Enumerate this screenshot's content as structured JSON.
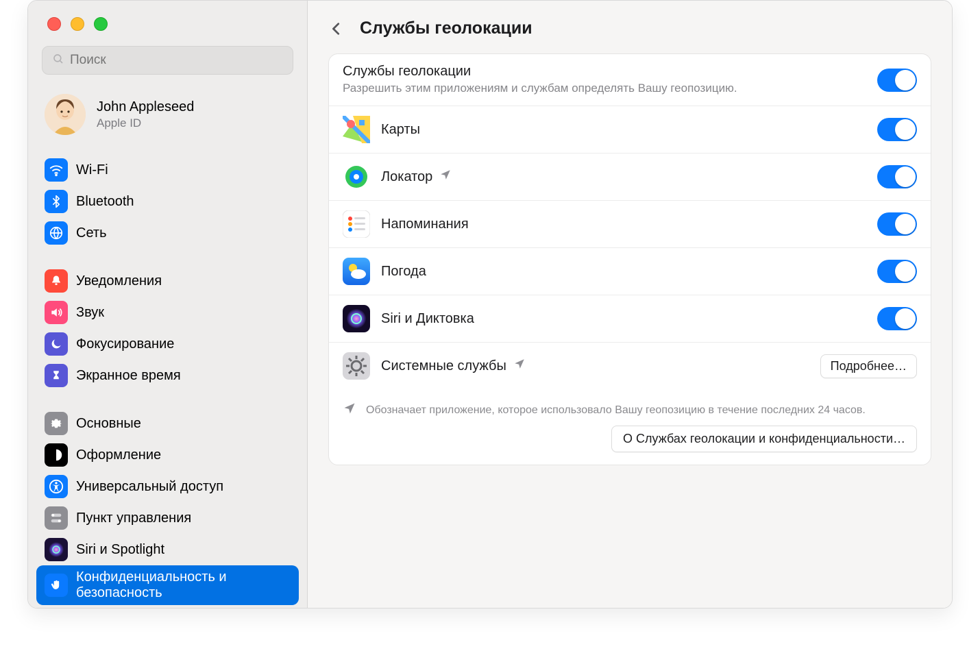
{
  "search": {
    "placeholder": "Поиск"
  },
  "account": {
    "name": "John Appleseed",
    "sub": "Apple ID"
  },
  "sidebar": {
    "groups": [
      [
        {
          "label": "Wi-Fi",
          "icon": "wifi",
          "bg": "#0a7aff"
        },
        {
          "label": "Bluetooth",
          "icon": "bluetooth",
          "bg": "#0a7aff"
        },
        {
          "label": "Сеть",
          "icon": "network",
          "bg": "#0a7aff"
        }
      ],
      [
        {
          "label": "Уведомления",
          "icon": "bell",
          "bg": "#ff4b3a"
        },
        {
          "label": "Звук",
          "icon": "sound",
          "bg": "#ff4b7c"
        },
        {
          "label": "Фокусирование",
          "icon": "moon",
          "bg": "#5856d6"
        },
        {
          "label": "Экранное время",
          "icon": "hourglass",
          "bg": "#5856d6"
        }
      ],
      [
        {
          "label": "Основные",
          "icon": "gear",
          "bg": "#8e8e93"
        },
        {
          "label": "Оформление",
          "icon": "appearance",
          "bg": "#000000"
        },
        {
          "label": "Универсальный доступ",
          "icon": "accessibility",
          "bg": "#0a7aff"
        },
        {
          "label": "Пункт управления",
          "icon": "controlcenter",
          "bg": "#8e8e93"
        },
        {
          "label": "Siri и Spotlight",
          "icon": "siri",
          "bg": "grad-siri"
        },
        {
          "label": "Конфиденциальность и безопасность",
          "icon": "hand",
          "bg": "#0a7aff",
          "selected": true
        }
      ]
    ]
  },
  "main": {
    "title": "Службы геолокации",
    "header_title": "Службы геолокации",
    "header_desc": "Разрешить этим приложениям и службам определять Вашу геопозицию.",
    "apps": [
      {
        "label": "Карты",
        "icon": "maps",
        "indicator": false,
        "toggle": true
      },
      {
        "label": "Локатор",
        "icon": "findmy",
        "indicator": true,
        "toggle": true
      },
      {
        "label": "Напоминания",
        "icon": "reminders",
        "indicator": false,
        "toggle": true
      },
      {
        "label": "Погода",
        "icon": "weather",
        "indicator": false,
        "toggle": true
      },
      {
        "label": "Siri и Диктовка",
        "icon": "siri",
        "indicator": false,
        "toggle": true
      },
      {
        "label": "Системные службы",
        "icon": "system",
        "indicator": true,
        "button": "Подробнее…"
      }
    ],
    "footnote": "Обозначает приложение, которое использовало Вашу геопозицию в течение последних 24 часов.",
    "about_button": "О Службах геолокации и конфиденциальности…"
  }
}
